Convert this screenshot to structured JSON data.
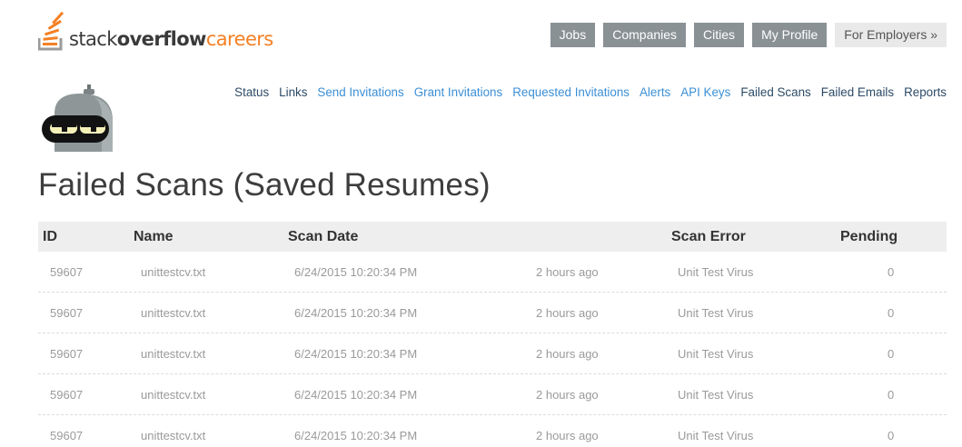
{
  "logo": {
    "part1": "stack",
    "part2": "overflow",
    "part3": "careers",
    "brand_color": "#f48024"
  },
  "topnav": {
    "items": [
      {
        "label": "Jobs"
      },
      {
        "label": "Companies"
      },
      {
        "label": "Cities"
      },
      {
        "label": "My Profile"
      },
      {
        "label": "For Employers »"
      }
    ]
  },
  "avatar": {
    "icon": "robot-avatar-icon"
  },
  "subnav": {
    "items": [
      {
        "label": "Status"
      },
      {
        "label": "Links"
      },
      {
        "label": "Send Invitations"
      },
      {
        "label": "Grant Invitations"
      },
      {
        "label": "Requested Invitations"
      },
      {
        "label": "Alerts"
      },
      {
        "label": "API Keys"
      },
      {
        "label": "Failed Scans"
      },
      {
        "label": "Failed Emails"
      },
      {
        "label": "Reports"
      }
    ]
  },
  "page": {
    "title": "Failed Scans (Saved Resumes)"
  },
  "table": {
    "headers": {
      "id": "ID",
      "name": "Name",
      "scan_date": "Scan Date",
      "scan_error": "Scan Error",
      "pending": "Pending"
    },
    "rows": [
      {
        "id": "59607",
        "name": "unittestcv.txt",
        "date": "6/24/2015 10:20:34 PM",
        "ago": "2 hours ago",
        "error": "Unit Test Virus",
        "pending": "0"
      },
      {
        "id": "59607",
        "name": "unittestcv.txt",
        "date": "6/24/2015 10:20:34 PM",
        "ago": "2 hours ago",
        "error": "Unit Test Virus",
        "pending": "0"
      },
      {
        "id": "59607",
        "name": "unittestcv.txt",
        "date": "6/24/2015 10:20:34 PM",
        "ago": "2 hours ago",
        "error": "Unit Test Virus",
        "pending": "0"
      },
      {
        "id": "59607",
        "name": "unittestcv.txt",
        "date": "6/24/2015 10:20:34 PM",
        "ago": "2 hours ago",
        "error": "Unit Test Virus",
        "pending": "0"
      },
      {
        "id": "59607",
        "name": "unittestcv.txt",
        "date": "6/24/2015 10:20:34 PM",
        "ago": "2 hours ago",
        "error": "Unit Test Virus",
        "pending": "0"
      }
    ]
  }
}
